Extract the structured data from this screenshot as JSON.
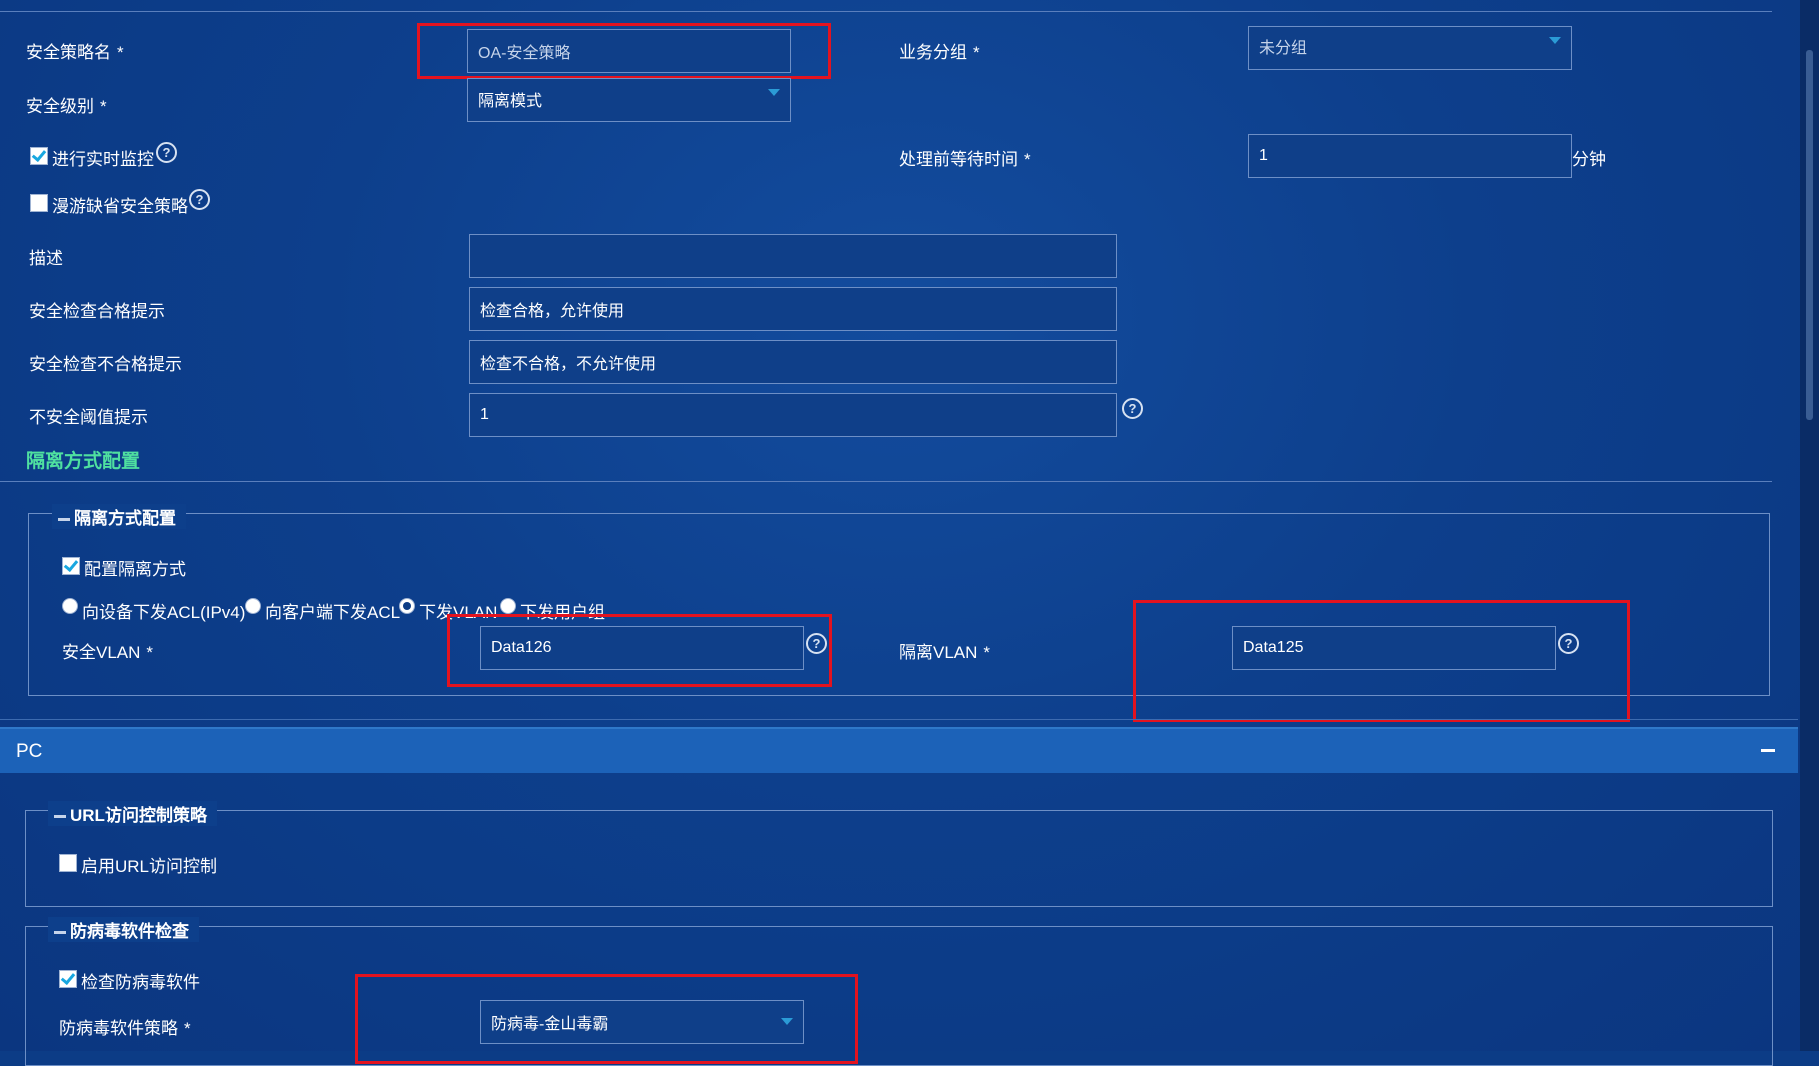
{
  "form": {
    "policy_name_label": "安全策略名",
    "policy_name_value": "OA-安全策略",
    "biz_group_label": "业务分组",
    "biz_group_value": "未分组",
    "security_level_label": "安全级别",
    "security_level_value": "隔离模式",
    "realtime_monitor_label": "进行实时监控",
    "realtime_monitor_checked": true,
    "wait_time_label": "处理前等待时间",
    "wait_time_value": "1",
    "wait_time_unit": "分钟",
    "roaming_default_label": "漫游缺省安全策略",
    "roaming_default_checked": false,
    "description_label": "描述",
    "description_value": "",
    "pass_tip_label": "安全检查合格提示",
    "pass_tip_value": "检查合格，允许使用",
    "fail_tip_label": "安全检查不合格提示",
    "fail_tip_value": "检查不合格，不允许使用",
    "threshold_tip_label": "不安全阈值提示",
    "threshold_tip_value": "1",
    "required_mark": "*"
  },
  "isolation": {
    "section_title": "隔离方式配置",
    "fieldset_title": "隔离方式配置",
    "configure_label": "配置隔离方式",
    "configure_checked": true,
    "radio_options": [
      "向设备下发ACL(IPv4)",
      "向客户端下发ACL",
      "下发VLAN",
      "下发用户组"
    ],
    "radio_selected": "下发VLAN",
    "safe_vlan_label": "安全VLAN",
    "safe_vlan_value": "Data126",
    "isolate_vlan_label": "隔离VLAN",
    "isolate_vlan_value": "Data125"
  },
  "pc_panel": {
    "title": "PC",
    "collapse_symbol": "−",
    "url_fieldset_title": "URL访问控制策略",
    "url_enable_label": "启用URL访问控制",
    "url_enable_checked": false,
    "av_fieldset_title": "防病毒软件检查",
    "av_check_label": "检查防病毒软件",
    "av_check_checked": true,
    "av_policy_label": "防病毒软件策略",
    "av_policy_value": "防病毒-金山毒霸"
  },
  "icons": {
    "help": "?"
  }
}
